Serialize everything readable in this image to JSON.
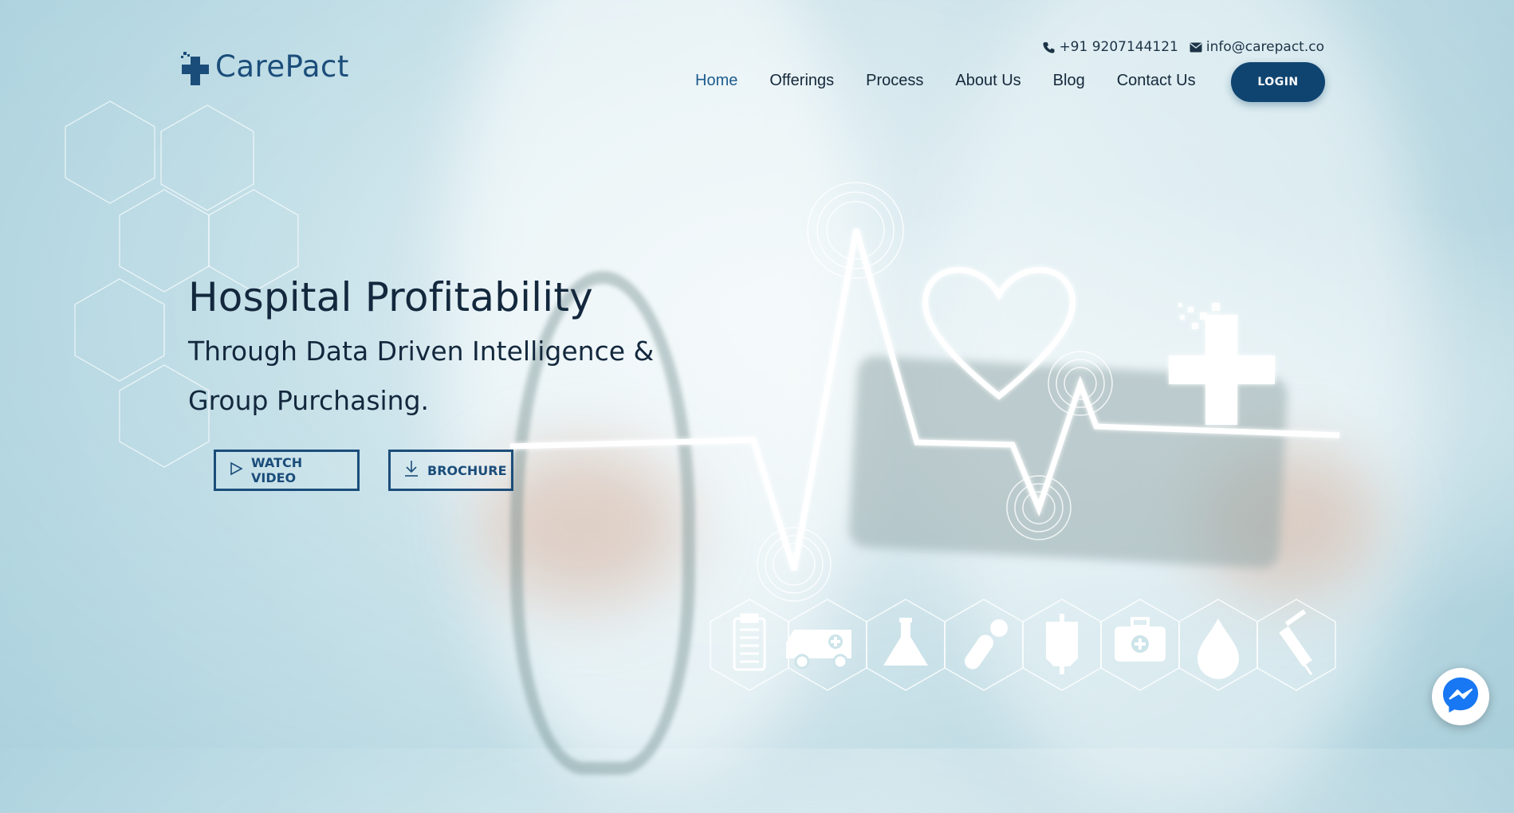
{
  "brand": {
    "name": "CarePact",
    "color": "#1b4d7a"
  },
  "contact": {
    "phone": "+91 9207144121",
    "email": "info@carepact.co",
    "phone_icon": "phone-icon",
    "email_icon": "envelope-icon"
  },
  "nav": {
    "items": [
      {
        "label": "Home",
        "active": true
      },
      {
        "label": "Offerings",
        "active": false
      },
      {
        "label": "Process",
        "active": false
      },
      {
        "label": "About Us",
        "active": false
      },
      {
        "label": "Blog",
        "active": false
      },
      {
        "label": "Contact Us",
        "active": false
      }
    ],
    "login_label": "LOGIN"
  },
  "hero": {
    "title": "Hospital Profitability",
    "subtitle": "Through Data Driven Intelligence & Group Purchasing.",
    "watch_video_label": "WATCH VIDEO",
    "brochure_label": "BROCHURE"
  },
  "medical_icons": [
    "clipboard-icon",
    "ambulance-icon",
    "flask-icon",
    "pills-icon",
    "iv-bag-icon",
    "first-aid-kit-icon",
    "blood-drop-icon",
    "syringe-icon"
  ],
  "colors": {
    "accent": "#0f4470",
    "text_dark": "#13283d",
    "nav_active": "#1d5c8f",
    "messenger": "#1877f2"
  }
}
